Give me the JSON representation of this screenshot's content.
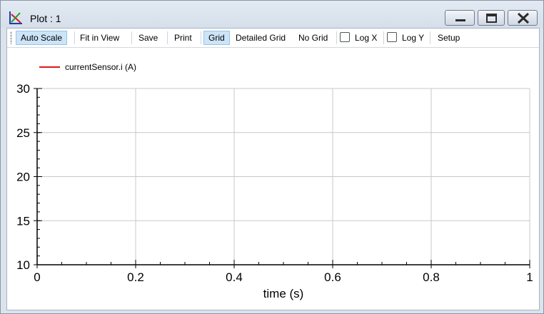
{
  "window": {
    "title": "Plot : 1",
    "app_icon": "plot-axes-icon",
    "controls": [
      "minimize-icon",
      "maximize-icon",
      "close-icon"
    ]
  },
  "toolbar": {
    "auto_scale": "Auto Scale",
    "fit_in_view": "Fit in View",
    "save": "Save",
    "print": "Print",
    "grid": "Grid",
    "detailed_grid": "Detailed Grid",
    "no_grid": "No Grid",
    "log_x": "Log X",
    "log_y": "Log Y",
    "setup": "Setup",
    "log_x_checked": false,
    "log_y_checked": false,
    "active": [
      "Auto Scale",
      "Grid"
    ]
  },
  "chart_data": {
    "type": "line",
    "title": "",
    "xlabel": "time (s)",
    "ylabel": "",
    "xlim": [
      0,
      1
    ],
    "ylim": [
      10,
      30
    ],
    "xticks": [
      0,
      0.2,
      0.4,
      0.6,
      0.8,
      1
    ],
    "xtick_labels": [
      "0",
      "0.2",
      "0.4",
      "0.6",
      "0.8",
      "1"
    ],
    "yticks": [
      10,
      15,
      20,
      25,
      30
    ],
    "ytick_labels": [
      "10",
      "15",
      "20",
      "25",
      "30"
    ],
    "grid": true,
    "legend_position": "top-left",
    "series": [
      {
        "name": "currentSensor.i (A)",
        "color": "#e0161b",
        "x": [],
        "y": []
      }
    ]
  }
}
